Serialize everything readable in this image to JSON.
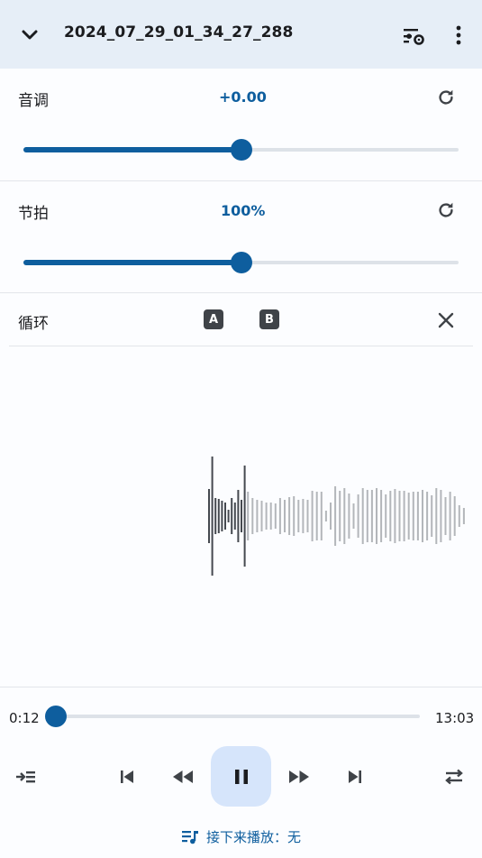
{
  "header": {
    "title": "2024_07_29_01_34_27_288",
    "collapse_icon": "chevron-down-icon",
    "settings_icon": "tune-settings-icon",
    "more_icon": "more-vert-icon"
  },
  "pitch": {
    "label": "音调",
    "value": "+0.00",
    "level": 0.5
  },
  "tempo": {
    "label": "节拍",
    "value": "100%",
    "level": 0.5
  },
  "loop": {
    "label": "循环",
    "a_label": "A",
    "b_label": "B"
  },
  "playback": {
    "current_time": "0:12",
    "total_time": "13:03",
    "progress": 0.015
  },
  "controls": {
    "queue_icon": "playlist-add-icon",
    "prev_icon": "skip-previous-icon",
    "rewind_icon": "rewind-icon",
    "play_state": "pause-icon",
    "forward_icon": "fast-forward-icon",
    "next_icon": "skip-next-icon",
    "repeat_icon": "repeat-icon"
  },
  "up_next": {
    "text": "接下来播放：无"
  },
  "colors": {
    "accent": "#0e5e9e",
    "topbar_bg": "#e6eef7",
    "play_bg": "#d6e5fb"
  }
}
